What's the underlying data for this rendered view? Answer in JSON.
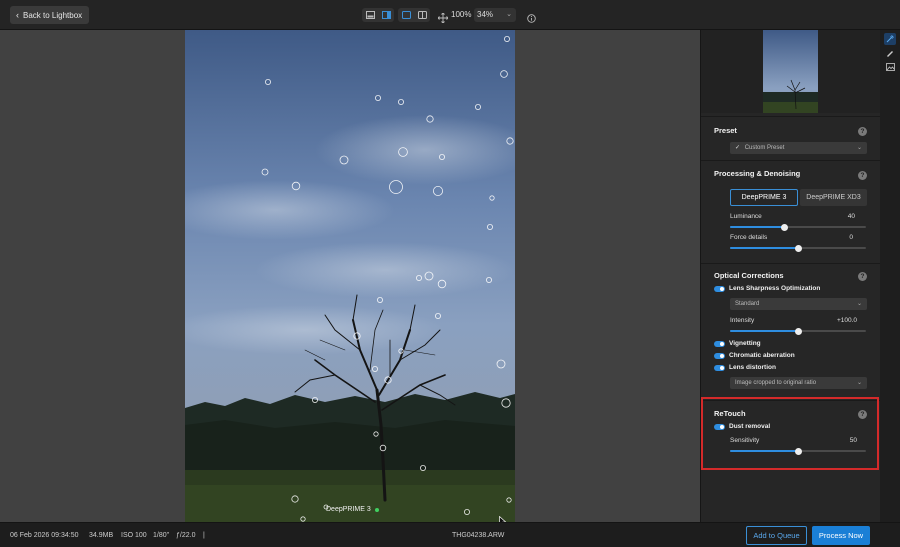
{
  "toolbar": {
    "back_label": "Back to Lightbox",
    "zoom_fit": "100%",
    "zoom_level": "34%"
  },
  "photo": {
    "overlay_label": "DeepPRIME 3"
  },
  "panel": {
    "preset": {
      "title": "Preset",
      "value": "Custom Preset"
    },
    "processing": {
      "title": "Processing & Denoising",
      "modes": [
        "DeepPRIME 3",
        "DeepPRIME XD3"
      ],
      "active_mode": "DeepPRIME 3",
      "luminance_label": "Luminance",
      "luminance_value": "40",
      "luminance_level": 0.4,
      "force_label": "Force details",
      "force_value": "0",
      "force_level": 0.5
    },
    "optical": {
      "title": "Optical Corrections",
      "lens_sharpness_label": "Lens Sharpness Optimization",
      "sharpness_mode": "Standard",
      "intensity_label": "Intensity",
      "intensity_value": "+100.0",
      "intensity_level": 0.5,
      "vignetting_label": "Vignetting",
      "chromatic_label": "Chromatic aberration",
      "distortion_label": "Lens distortion",
      "distortion_mode": "Image cropped to original ratio"
    },
    "retouch": {
      "title": "ReTouch",
      "dust_label": "Dust removal",
      "sensitivity_label": "Sensitivity",
      "sensitivity_value": "50",
      "sensitivity_level": 0.5
    }
  },
  "statusbar": {
    "date": "06 Feb 2026 09:34:50",
    "size": "34.9MB",
    "iso": "ISO 100",
    "shutter": "1/80\"",
    "aperture": "ƒ/22.0",
    "separator": "|",
    "filename": "THG04238.ARW",
    "add_to_queue": "Add to Queue",
    "process_now": "Process Now"
  },
  "colors": {
    "accent": "#2e8de0",
    "highlight": "#d42a2a",
    "status_dot": "#40d060"
  }
}
